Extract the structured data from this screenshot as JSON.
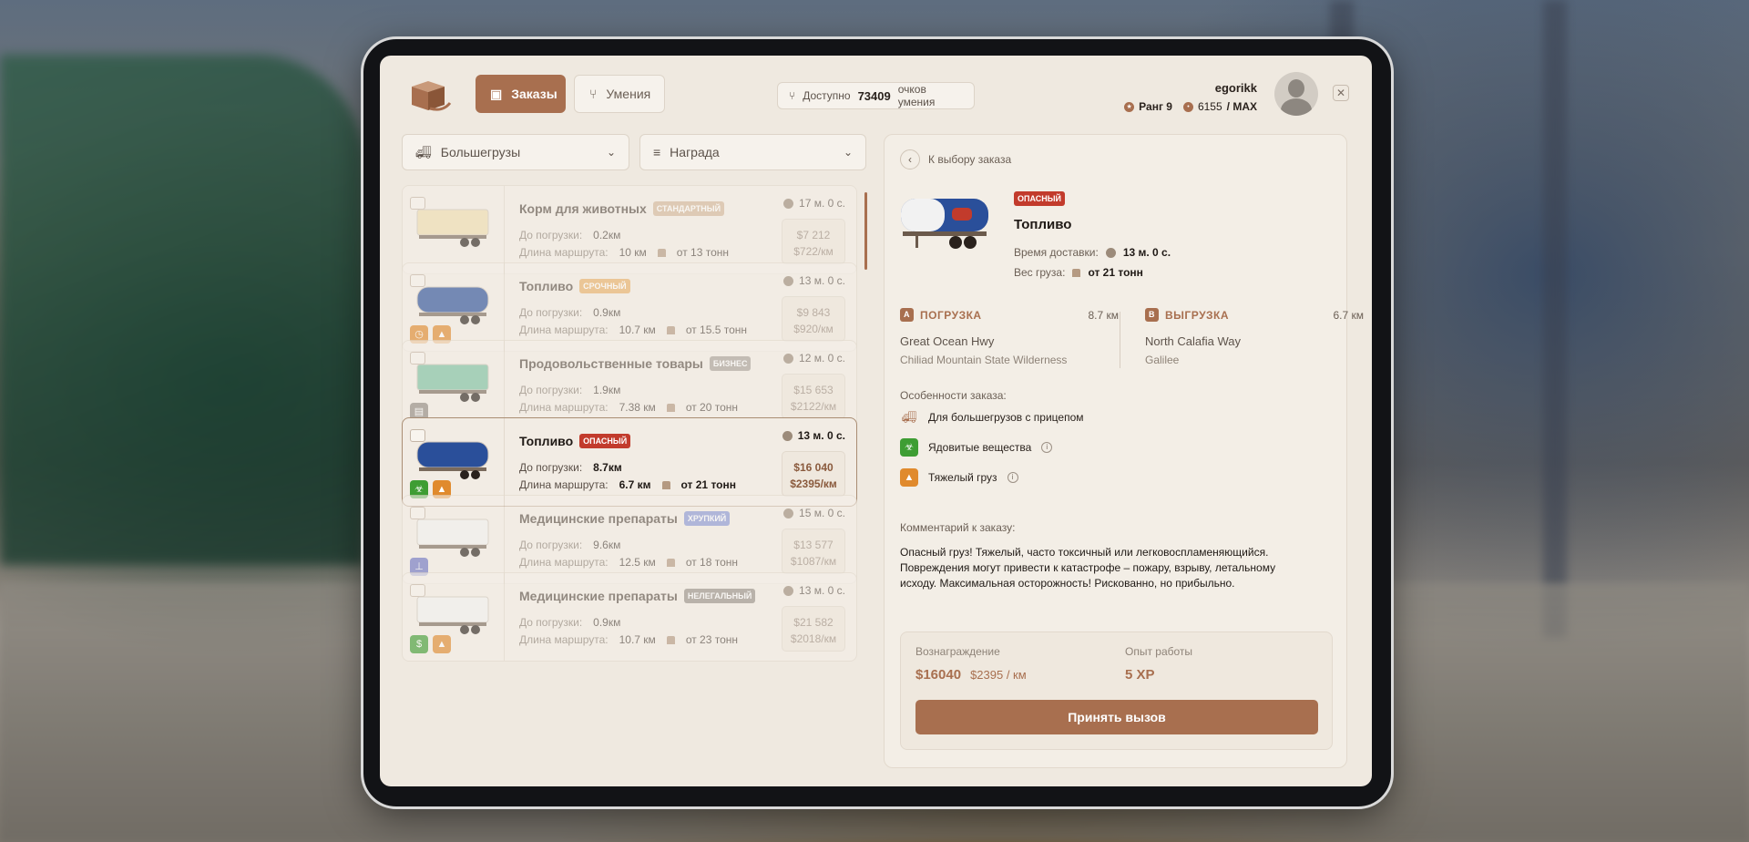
{
  "header": {
    "tabs": [
      {
        "label": "Заказы",
        "active": true
      },
      {
        "label": "Умения",
        "active": false
      }
    ],
    "points_prefix": "Доступно",
    "points_value": "73409",
    "points_suffix": "очков умения",
    "user": {
      "name": "egorikk",
      "rank": "Ранг 9",
      "xp": "6155",
      "xp_max": "/ MAX"
    },
    "close_icon": "close-icon"
  },
  "filters": [
    {
      "label": "Большегрузы",
      "icon": "truck-icon"
    },
    {
      "label": "Награда",
      "icon": "filter-icon"
    }
  ],
  "orders": [
    {
      "title": "Корм для животных",
      "tag": "СТАНДАРТНЫЙ",
      "tag_color": "#d4b89b",
      "time": "17 м. 0 с.",
      "distance_label": "До погрузки:",
      "distance": "0.2км",
      "route_label": "Длина маршрута:",
      "route": "10 км",
      "weight": "от 13 тонн",
      "price": "$7 212",
      "per_km": "$722/км",
      "badges": [],
      "trailer_color": "#f0dfb0"
    },
    {
      "title": "Топливо",
      "tag": "СРОЧНЫЙ",
      "tag_color": "#e9b169",
      "time": "13 м. 0 с.",
      "distance_label": "До погрузки:",
      "distance": "0.9км",
      "route_label": "Длина маршрута:",
      "route": "10.7 км",
      "weight": "от 15.5 тонн",
      "price": "$9 843",
      "per_km": "$920/км",
      "badges": [
        {
          "icon": "clock-badge-icon",
          "color": "#e08a2d"
        },
        {
          "icon": "weight-badge-icon",
          "color": "#e08a2d"
        }
      ],
      "trailer_color": "#2a4f9a"
    },
    {
      "title": "Продовольственные товары",
      "tag": "БИЗНЕС",
      "tag_color": "#a9a29a",
      "time": "12 м. 0 с.",
      "distance_label": "До погрузки:",
      "distance": "1.9км",
      "route_label": "Длина маршрута:",
      "route": "7.38 км",
      "weight": "от 20 тонн",
      "price": "$15 653",
      "per_km": "$2122/км",
      "badges": [
        {
          "icon": "briefcase-badge-icon",
          "color": "#918a82"
        }
      ],
      "trailer_color": "#7cc2a2"
    },
    {
      "title": "Топливо",
      "tag": "ОПАСНЫЙ",
      "tag_color": "#c23b2c",
      "time": "13 м. 0 с.",
      "distance_label": "До погрузки:",
      "distance": "8.7км",
      "route_label": "Длина маршрута:",
      "route": "6.7 км",
      "weight": "от 21 тонн",
      "price": "$16 040",
      "per_km": "$2395/км",
      "badges": [
        {
          "icon": "biohazard-badge-icon",
          "color": "#3e9d33"
        },
        {
          "icon": "weight-badge-icon",
          "color": "#e08a2d"
        }
      ],
      "trailer_color": "#2a4f9a",
      "active": true
    },
    {
      "title": "Медицинские препараты",
      "tag": "ХРУПКИЙ",
      "tag_color": "#8a97d6",
      "time": "15 м. 0 с.",
      "distance_label": "До погрузки:",
      "distance": "9.6км",
      "route_label": "Длина маршрута:",
      "route": "12.5 км",
      "weight": "от 18 тонн",
      "price": "$13 577",
      "per_km": "$1087/км",
      "badges": [
        {
          "icon": "fragile-badge-icon",
          "color": "#6f76c4"
        }
      ],
      "trailer_color": "#f3f3f3"
    },
    {
      "title": "Медицинские препараты",
      "tag": "НЕЛЕГАЛЬНЫЙ",
      "tag_color": "#99928a",
      "time": "13 м. 0 с.",
      "distance_label": "До погрузки:",
      "distance": "0.9км",
      "route_label": "Длина маршрута:",
      "route": "10.7 км",
      "weight": "от 23 тонн",
      "price": "$21 582",
      "per_km": "$2018/км",
      "badges": [
        {
          "icon": "dollar-badge-icon",
          "color": "#3e9d33"
        },
        {
          "icon": "weight-badge-icon",
          "color": "#e08a2d"
        }
      ],
      "trailer_color": "#f3f3f3"
    }
  ],
  "detail": {
    "back_label": "К выбору заказа",
    "tag": "ОПАСНЫЙ",
    "title": "Топливо",
    "delivery_label": "Время доставки:",
    "delivery_time": "13 м. 0 с.",
    "weight_label": "Вес груза:",
    "weight": "от 21 тонн",
    "loading": {
      "letter": "A",
      "label": "ПОГРУЗКА",
      "km": "8.7 км",
      "street": "Great Ocean Hwy",
      "area": "Chiliad Mountain State Wilderness"
    },
    "unloading": {
      "letter": "B",
      "label": "ВЫГРУЗКА",
      "km": "6.7 км",
      "street": "North Calafia Way",
      "area": "Galilee"
    },
    "features_label": "Особенности заказа:",
    "features": [
      {
        "label": "Для большегрузов с прицепом",
        "icon": "truck-icon"
      },
      {
        "label": "Ядовитые вещества",
        "icon": "biohazard-icon"
      },
      {
        "label": "Тяжелый груз",
        "icon": "weight-icon"
      }
    ],
    "comment_label": "Комментарий к заказу:",
    "comment": "Опасный груз! Тяжелый, часто токсичный или легковоспламеняющийся. Повреждения могут привести к катастрофе – пожару, взрыву, летальному исходу. Максимальная осторожность! Рискованно, но прибыльно.",
    "reward_label": "Вознаграждение",
    "reward_value": "$16040",
    "reward_per_km": "$2395 / км",
    "xp_label": "Опыт работы",
    "xp_value": "5 XP",
    "accept_label": "Принять вызов"
  },
  "colors": {
    "accent": "#a86f4f",
    "danger": "#c23b2c",
    "background": "#efe9e0"
  }
}
